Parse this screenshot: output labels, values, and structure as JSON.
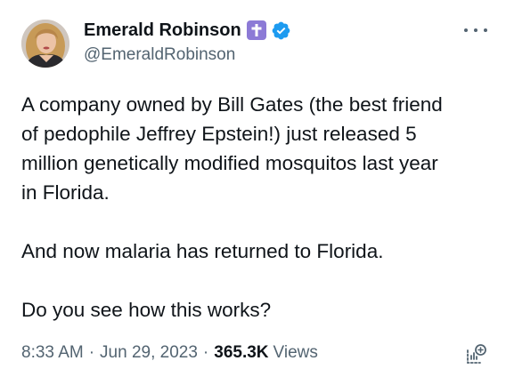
{
  "author": {
    "display_name": "Emerald Robinson",
    "handle": "@EmeraldRobinson",
    "avatar_icon": "profile-photo",
    "badges": [
      "cross-icon",
      "verified-badge-icon"
    ],
    "cross_badge_color": "#8c7ad6",
    "verified_badge_color": "#1d9bf0"
  },
  "menu": {
    "icon": "more-horizontal-icon"
  },
  "tweet": {
    "paragraph_1": [
      "A company owned by Bill Gates (the best friend",
      "of pedophile Jeffrey Epstein!) just released 5",
      "million genetically modified mosquitos last year",
      "in Florida."
    ],
    "paragraph_2": "And now malaria has returned to Florida.",
    "paragraph_3": "Do you see how this works?"
  },
  "meta": {
    "time": "8:33 AM",
    "separator": "·",
    "date": "Jun 29, 2023",
    "views_count": "365.3K",
    "views_label": "Views",
    "analytics_icon": "analytics-icon"
  },
  "colors": {
    "text": "#0f1419",
    "secondary_text": "#536471",
    "background": "#ffffff"
  }
}
